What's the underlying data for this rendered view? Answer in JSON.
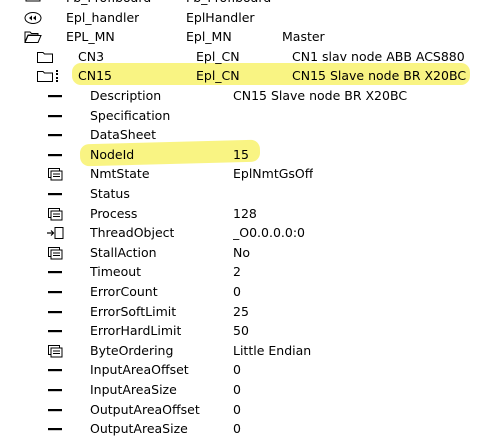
{
  "colors": {
    "highlight": "#f7f05a",
    "text": "#000000",
    "background": "#ffffff"
  },
  "rows": [
    {
      "icon": "link-icon",
      "c1": "Fb_Profiboard",
      "c2": "Fb_Profiboard",
      "c3": ""
    },
    {
      "icon": "handler-icon",
      "c1": "Epl_handler",
      "c2": "EplHandler",
      "c3": ""
    },
    {
      "icon": "folder-open-icon",
      "c1": "EPL_MN",
      "c2": "Epl_MN",
      "c3": "Master"
    },
    {
      "icon": "folder-icon",
      "c1": "CN3",
      "c2": "Epl_CN",
      "c3": "CN1 slav node ABB ACS880"
    },
    {
      "icon": "folder-icon",
      "c1": "CN15",
      "c2": "Epl_CN",
      "c3": "CN15 Slave node BR X20BC"
    },
    {
      "icon": "attr-icon",
      "c1": "Description",
      "c3": "CN15 Slave node BR X20BC"
    },
    {
      "icon": "attr-icon",
      "c1": "Specification",
      "c3": ""
    },
    {
      "icon": "attr-icon",
      "c1": "DataSheet",
      "c3": ""
    },
    {
      "icon": "attr-icon",
      "c1": "NodeId",
      "c3": "15"
    },
    {
      "icon": "enum-icon",
      "c1": "NmtState",
      "c3": "EplNmtGsOff"
    },
    {
      "icon": "attr-icon",
      "c1": "Status",
      "c3": ""
    },
    {
      "icon": "enum-icon",
      "c1": "Process",
      "c3": "128"
    },
    {
      "icon": "object-ref-icon",
      "c1": "ThreadObject",
      "c3": "_O0.0.0.0:0"
    },
    {
      "icon": "enum-icon",
      "c1": "StallAction",
      "c3": "No"
    },
    {
      "icon": "attr-icon",
      "c1": "Timeout",
      "c3": "2"
    },
    {
      "icon": "attr-icon",
      "c1": "ErrorCount",
      "c3": "0"
    },
    {
      "icon": "attr-icon",
      "c1": "ErrorSoftLimit",
      "c3": "25"
    },
    {
      "icon": "attr-icon",
      "c1": "ErrorHardLimit",
      "c3": "50"
    },
    {
      "icon": "enum-icon",
      "c1": "ByteOrdering",
      "c3": "Little Endian"
    },
    {
      "icon": "attr-icon",
      "c1": "InputAreaOffset",
      "c3": "0"
    },
    {
      "icon": "attr-icon",
      "c1": "InputAreaSize",
      "c3": "0"
    },
    {
      "icon": "attr-icon",
      "c1": "OutputAreaOffset",
      "c3": "0"
    },
    {
      "icon": "attr-icon",
      "c1": "OutputAreaSize",
      "c3": "0"
    }
  ]
}
